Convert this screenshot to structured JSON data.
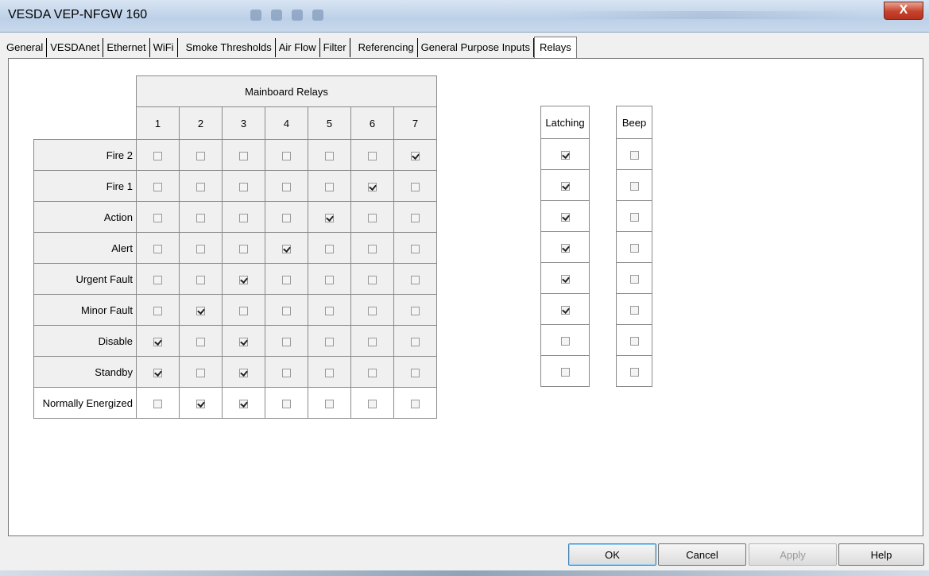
{
  "window": {
    "title": "VESDA VEP-NFGW  160",
    "close_label": "X"
  },
  "tabs": [
    {
      "label": "General"
    },
    {
      "label": "VESDAnet"
    },
    {
      "label": "Ethernet"
    },
    {
      "label": "WiFi"
    },
    {
      "label": "Smoke Thresholds"
    },
    {
      "label": "Air Flow"
    },
    {
      "label": "Filter"
    },
    {
      "label": "Referencing"
    },
    {
      "label": "General Purpose Inputs"
    },
    {
      "label": "Relays",
      "active": true
    }
  ],
  "relays": {
    "group_header": "Mainboard Relays",
    "columns": [
      "1",
      "2",
      "3",
      "4",
      "5",
      "6",
      "7"
    ],
    "rows": [
      {
        "label": "Fire 2",
        "checked": [
          false,
          false,
          false,
          false,
          false,
          false,
          true
        ]
      },
      {
        "label": "Fire 1",
        "checked": [
          false,
          false,
          false,
          false,
          false,
          true,
          false
        ]
      },
      {
        "label": "Action",
        "checked": [
          false,
          false,
          false,
          false,
          true,
          false,
          false
        ]
      },
      {
        "label": "Alert",
        "checked": [
          false,
          false,
          false,
          true,
          false,
          false,
          false
        ]
      },
      {
        "label": "Urgent Fault",
        "checked": [
          false,
          false,
          true,
          false,
          false,
          false,
          false
        ]
      },
      {
        "label": "Minor Fault",
        "checked": [
          false,
          true,
          false,
          false,
          false,
          false,
          false
        ]
      },
      {
        "label": "Disable",
        "checked": [
          true,
          false,
          true,
          false,
          false,
          false,
          false
        ]
      },
      {
        "label": "Standby",
        "checked": [
          true,
          false,
          true,
          false,
          false,
          false,
          false
        ]
      },
      {
        "label": "Normally Energized",
        "checked": [
          false,
          true,
          true,
          false,
          false,
          false,
          false
        ]
      }
    ]
  },
  "latching": {
    "header": "Latching",
    "checked": [
      true,
      true,
      true,
      true,
      true,
      true,
      false,
      false
    ]
  },
  "beep": {
    "header": "Beep",
    "checked": [
      false,
      false,
      false,
      false,
      false,
      false,
      false,
      false
    ]
  },
  "buttons": {
    "ok": "OK",
    "cancel": "Cancel",
    "apply": "Apply",
    "help": "Help"
  }
}
